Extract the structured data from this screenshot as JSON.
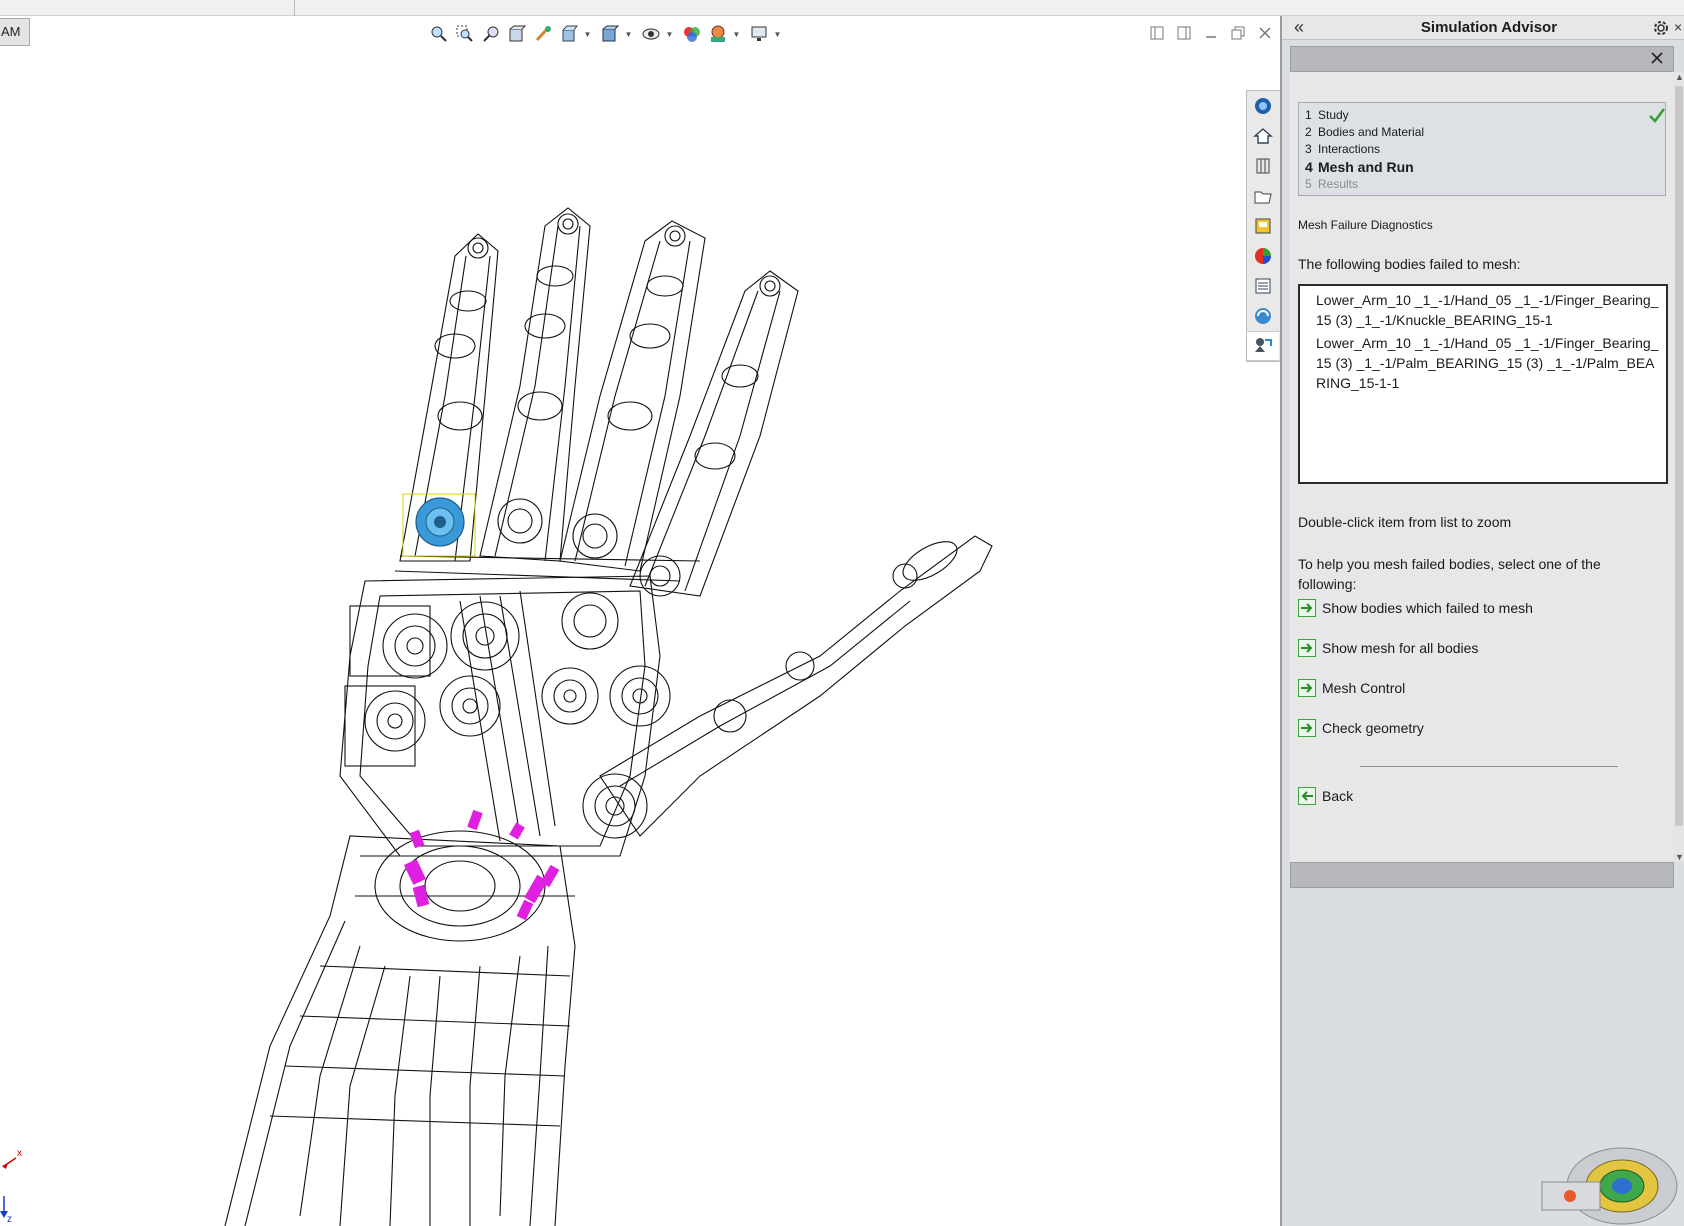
{
  "window": {
    "tab_stub_label": "AM"
  },
  "advisor": {
    "title": "Simulation Advisor",
    "steps": [
      {
        "num": "1",
        "label": "Study",
        "state": "done"
      },
      {
        "num": "2",
        "label": "Bodies and Material",
        "state": "done"
      },
      {
        "num": "3",
        "label": "Interactions",
        "state": "done"
      },
      {
        "num": "4",
        "label": "Mesh and Run",
        "state": "current"
      },
      {
        "num": "5",
        "label": "Results",
        "state": "disabled"
      }
    ],
    "diagnostics_title": "Mesh Failure Diagnostics",
    "failed_label": "The following bodies failed to mesh:",
    "failed_bodies": [
      "Lower_Arm_10 _1_-1/Hand_05 _1_-1/Finger_Bearing_15 (3) _1_-1/Knuckle_BEARING_15-1",
      "Lower_Arm_10 _1_-1/Hand_05 _1_-1/Finger_Bearing_15 (3) _1_-1/Palm_BEARING_15 (3) _1_-1/Palm_BEARING_15-1-1"
    ],
    "zoom_hint": "Double-click item from list to zoom",
    "help_text": "To help you mesh failed bodies, select one of the following:",
    "actions": [
      "Show bodies which failed to mesh",
      "Show mesh for all bodies",
      "Mesh Control",
      "Check geometry"
    ],
    "back_label": "Back"
  },
  "triad": {
    "x_label": "x",
    "z_label": "z"
  },
  "colors": {
    "panel_bg": "#dadde2",
    "selection_blue": "#3a9ad9",
    "highlight_magenta": "#e020e0",
    "action_arrow_green": "#3aa33a"
  },
  "icons": {
    "view_toolbar": [
      "zoom-to-fit-icon",
      "zoom-to-area-icon",
      "previous-view-icon",
      "section-view-icon",
      "dynamic-annotation-icon",
      "view-orientation-icon",
      "display-style-icon",
      "hide-show-items-icon",
      "edit-appearance-icon",
      "apply-scene-icon",
      "view-settings-icon"
    ],
    "task_pane": [
      "solidworks-resources-icon",
      "home-icon",
      "design-library-icon",
      "file-explorer-icon",
      "view-palette-icon",
      "appearances-icon",
      "custom-properties-icon",
      "solidworks-forum-icon",
      "simulation-advisor-icon"
    ]
  }
}
